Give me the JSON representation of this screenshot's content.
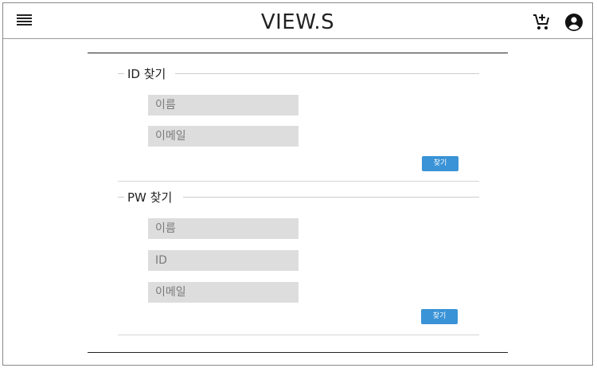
{
  "header": {
    "logo": "VIEW.S",
    "menu_icon": "hamburger-menu-icon",
    "cart_icon": "add-shopping-cart-icon",
    "account_icon": "account-circle-icon"
  },
  "id_find": {
    "title": "ID 찾기",
    "name_placeholder": "이름",
    "email_placeholder": "이메일",
    "submit_label": "찾기"
  },
  "pw_find": {
    "title": "PW 찾기",
    "name_placeholder": "이름",
    "id_placeholder": "ID",
    "email_placeholder": "이메일",
    "submit_label": "찾기"
  },
  "colors": {
    "button": "#3a93d6",
    "field_bg": "#dddddd"
  }
}
